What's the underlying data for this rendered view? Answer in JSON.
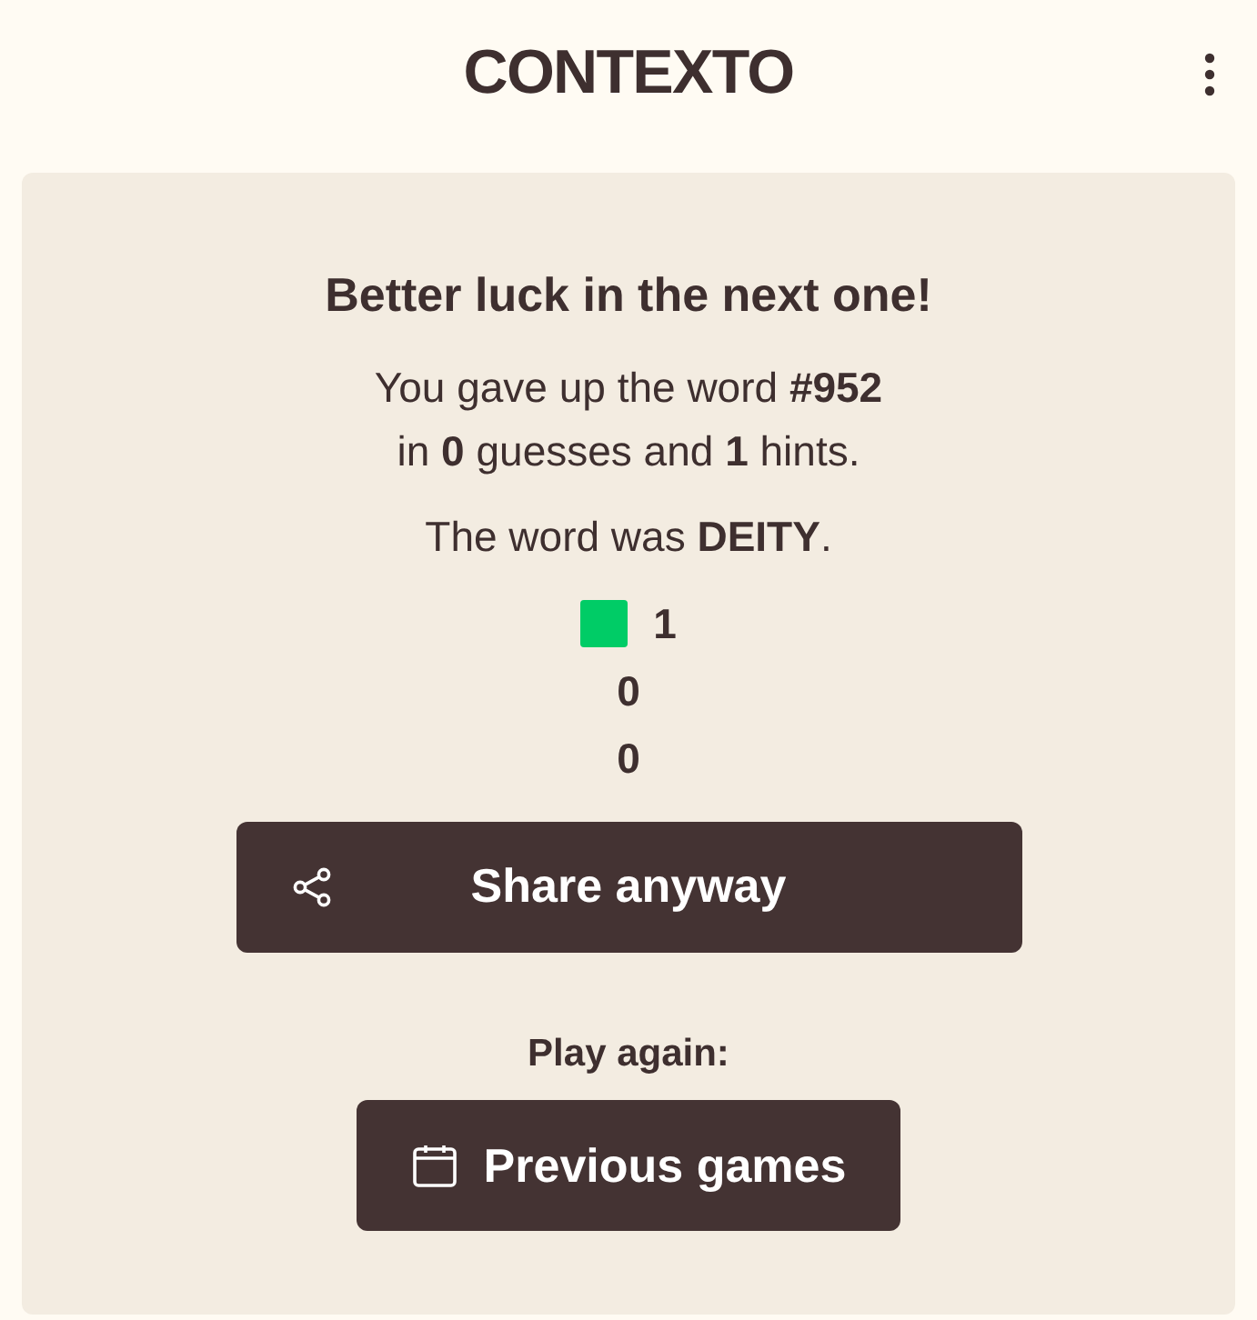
{
  "header": {
    "title": "CONTEXTO"
  },
  "result": {
    "heading": "Better luck in the next one!",
    "summary_lines": [
      "You gave up the word **#952**",
      "in **0** guesses and **1** hints."
    ],
    "answer": "The word was **DEITY**.",
    "stats": [
      {
        "count": "1",
        "color": "#00cc66"
      },
      {
        "count": "0"
      },
      {
        "count": "0"
      }
    ],
    "share_button": "Share anyway",
    "play_again_label": "Play again:",
    "previous_button": "Previous games"
  }
}
